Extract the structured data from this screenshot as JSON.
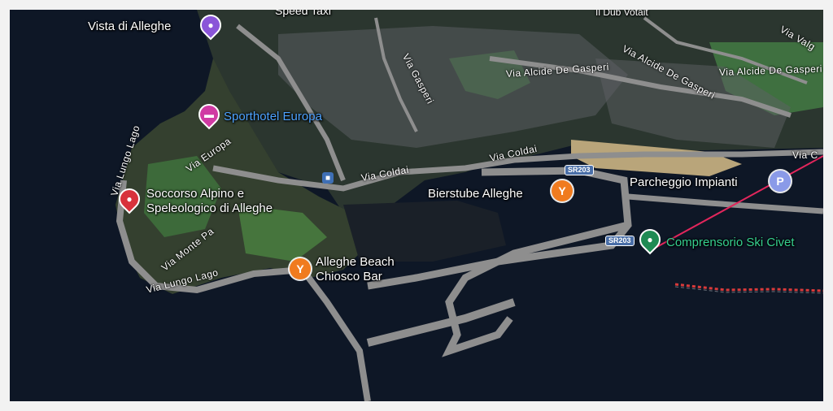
{
  "map": {
    "colors": {
      "water": "#0e1726",
      "land": "#2f3a33",
      "roads": "#8e8e8e",
      "cable_line": "#e2265c",
      "lake_route": "#d93a3a"
    },
    "places": {
      "vista": {
        "label": "Vista di Alleghe",
        "icon": "camera-icon",
        "color": "#8a55d8"
      },
      "sporthotel": {
        "label": "Sporthotel Europa",
        "icon": "bed-icon",
        "color": "#d03aa3"
      },
      "soccorso": {
        "label": "Soccorso Alpino e\nSpeleologico di Alleghe",
        "icon": "map-pin-icon",
        "color": "#d8323c"
      },
      "bierstube": {
        "label": "Bierstube Alleghe",
        "icon": "cocktail-icon",
        "color": "#f07b1f"
      },
      "beach": {
        "label": "Alleghe Beach\nChiosco Bar",
        "icon": "cocktail-icon",
        "color": "#f07b1f"
      },
      "parcheggio": {
        "label": "Parcheggio Impianti",
        "icon": "parking-icon",
        "color": "#8a9ae8",
        "glyph": "P"
      },
      "comprensorio": {
        "label": "Comprensorio Ski Civet",
        "icon": "ski-area-icon",
        "color": "#1e8a53"
      },
      "speed_taxi": {
        "label": "Speed Taxi"
      },
      "bar_top": {
        "label": "Il Dub Votait"
      }
    },
    "streets": {
      "via_lungo_lago_west": "Via Lungo Lago",
      "via_lungo_lago_south": "Via Lungo Lago",
      "via_europa": "Via Europa",
      "via_monte_pa": "Via Monte Pa",
      "via_coldai_1": "Via Coldai",
      "via_coldai_2": "Via Coldai",
      "via_coldai_3": "Via C",
      "via_gasperi_1": "Via Alcide De Gasperi",
      "via_gasperi_2": "Via Alcide De Gasperi",
      "via_gasperi_3": "Via Alcide De Gasperi",
      "via_valg": "Via Valg",
      "via_gasperi_short": "Via Gasperi"
    },
    "road_badges": {
      "sr203_a": "SR203",
      "sr203_b": "SR203"
    },
    "transit": {
      "bus_icon": "bus-stop-icon"
    }
  }
}
